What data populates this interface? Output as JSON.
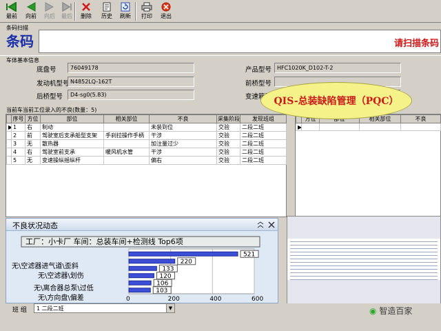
{
  "toolbar": {
    "buttons": [
      {
        "label": "最前",
        "icon": "first-arrow-icon",
        "enabled": true
      },
      {
        "label": "向前",
        "icon": "prev-arrow-icon",
        "enabled": true
      },
      {
        "label": "向后",
        "icon": "next-arrow-icon",
        "enabled": false
      },
      {
        "label": "最后",
        "icon": "last-arrow-icon",
        "enabled": false
      },
      {
        "label": "删除",
        "icon": "delete-icon",
        "enabled": true
      },
      {
        "label": "历史",
        "icon": "history-icon",
        "enabled": true
      },
      {
        "label": "刷新",
        "icon": "refresh-icon",
        "enabled": true
      },
      {
        "label": "打印",
        "icon": "print-icon",
        "enabled": true
      },
      {
        "label": "退出",
        "icon": "exit-icon",
        "enabled": true
      }
    ]
  },
  "barcode": {
    "section_label": "条码扫描",
    "big_label": "条码",
    "prompt": "请扫描条码"
  },
  "vehicle": {
    "section_label": "车体基本信息",
    "chassis_label": "底盘号",
    "chassis_value": "76049178",
    "engine_label": "发动机型号",
    "engine_value": "N4852LQ-162T",
    "rear_axle_label": "后桥型号",
    "rear_axle_value": "D4-sg0(5.83)",
    "product_label": "产品型号",
    "product_value": "HFC1020K_D102-T-2",
    "front_axle_label": "前桥型号",
    "front_axle_value": "",
    "gearbox_label": "变速箱型号",
    "gearbox_value": ""
  },
  "callout": "QIS-总装缺陷管理（PQC）",
  "defects": {
    "section_label": "当前车当前工位录入的不良(数量：5)",
    "columns": [
      "序号",
      "方位",
      "部位",
      "相关部位",
      "不良",
      "采集阶段",
      "发现班组"
    ],
    "rows": [
      [
        "1",
        "右",
        "制动",
        "",
        "未装到位",
        "交验",
        "二段二班"
      ],
      [
        "2",
        "前",
        "驾驶室后支承船型支架",
        "手刹拉操作手柄",
        "干涉",
        "交验",
        "二段二班"
      ],
      [
        "3",
        "无",
        "散热器",
        "",
        "加注量过少",
        "交验",
        "二段二班"
      ],
      [
        "4",
        "右",
        "驾驶室前支承",
        "暖风机水管",
        "干涉",
        "交验",
        "二段二班"
      ],
      [
        "5",
        "无",
        "变速操纵摇纵杆",
        "",
        "偏右",
        "交验",
        "二段二班"
      ]
    ]
  },
  "right_table": {
    "columns": [
      "方位",
      "部位",
      "相关部位",
      "不良"
    ]
  },
  "popup": {
    "title": "不良状况动态",
    "chart_title": "工厂：小卡厂 车间：总装车间+检测线 Top6项"
  },
  "bottom": {
    "team_label": "班 组",
    "team_value": "1 二段二班"
  },
  "watermark": "智造百家",
  "colors": {
    "callout_fill": "#f5f28a",
    "callout_text": "#cc1a1a",
    "bar_fill": "#3d4fd6",
    "barcode_blue": "#1a2fa8",
    "prompt_red": "#d01818"
  },
  "chart_data": {
    "type": "bar",
    "orientation": "horizontal",
    "title": "工厂：小卡厂 车间：总装车间+检测线 Top6项",
    "categories": [
      "无\\空滤器进气道\\歪斜",
      "无\\空滤器\\划伤",
      "无\\离合器总泵\\过低",
      "无\\方向盘\\偏差"
    ],
    "values": [
      521,
      220,
      133,
      120,
      106,
      103
    ],
    "xlim": [
      0,
      600
    ],
    "xticks": [
      "0",
      "200",
      "400",
      "600"
    ]
  }
}
